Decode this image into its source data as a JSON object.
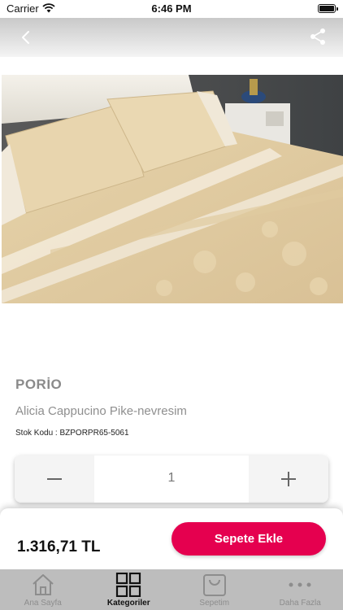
{
  "status_bar": {
    "carrier": "Carrier",
    "time": "6:46 PM"
  },
  "header": {
    "back_icon": "chevron-left-icon",
    "share_icon": "share-icon"
  },
  "product": {
    "brand": "PORİO",
    "name": "Alicia Cappucino Pike-nevresim",
    "sku": "Stok Kodu : BZPORPR65-5061"
  },
  "quantity": {
    "value": "1"
  },
  "purchase": {
    "price": "1.316,71 TL",
    "add_to_cart_label": "Sepete Ekle",
    "accent_color": "#e5004f"
  },
  "tabs": [
    {
      "label": "Ana Sayfa",
      "icon": "home-icon",
      "active": false
    },
    {
      "label": "Kategoriler",
      "icon": "grid-icon",
      "active": true
    },
    {
      "label": "Sepetim",
      "icon": "bag-icon",
      "active": false
    },
    {
      "label": "Daha Fazla",
      "icon": "more-icon",
      "active": false
    }
  ]
}
